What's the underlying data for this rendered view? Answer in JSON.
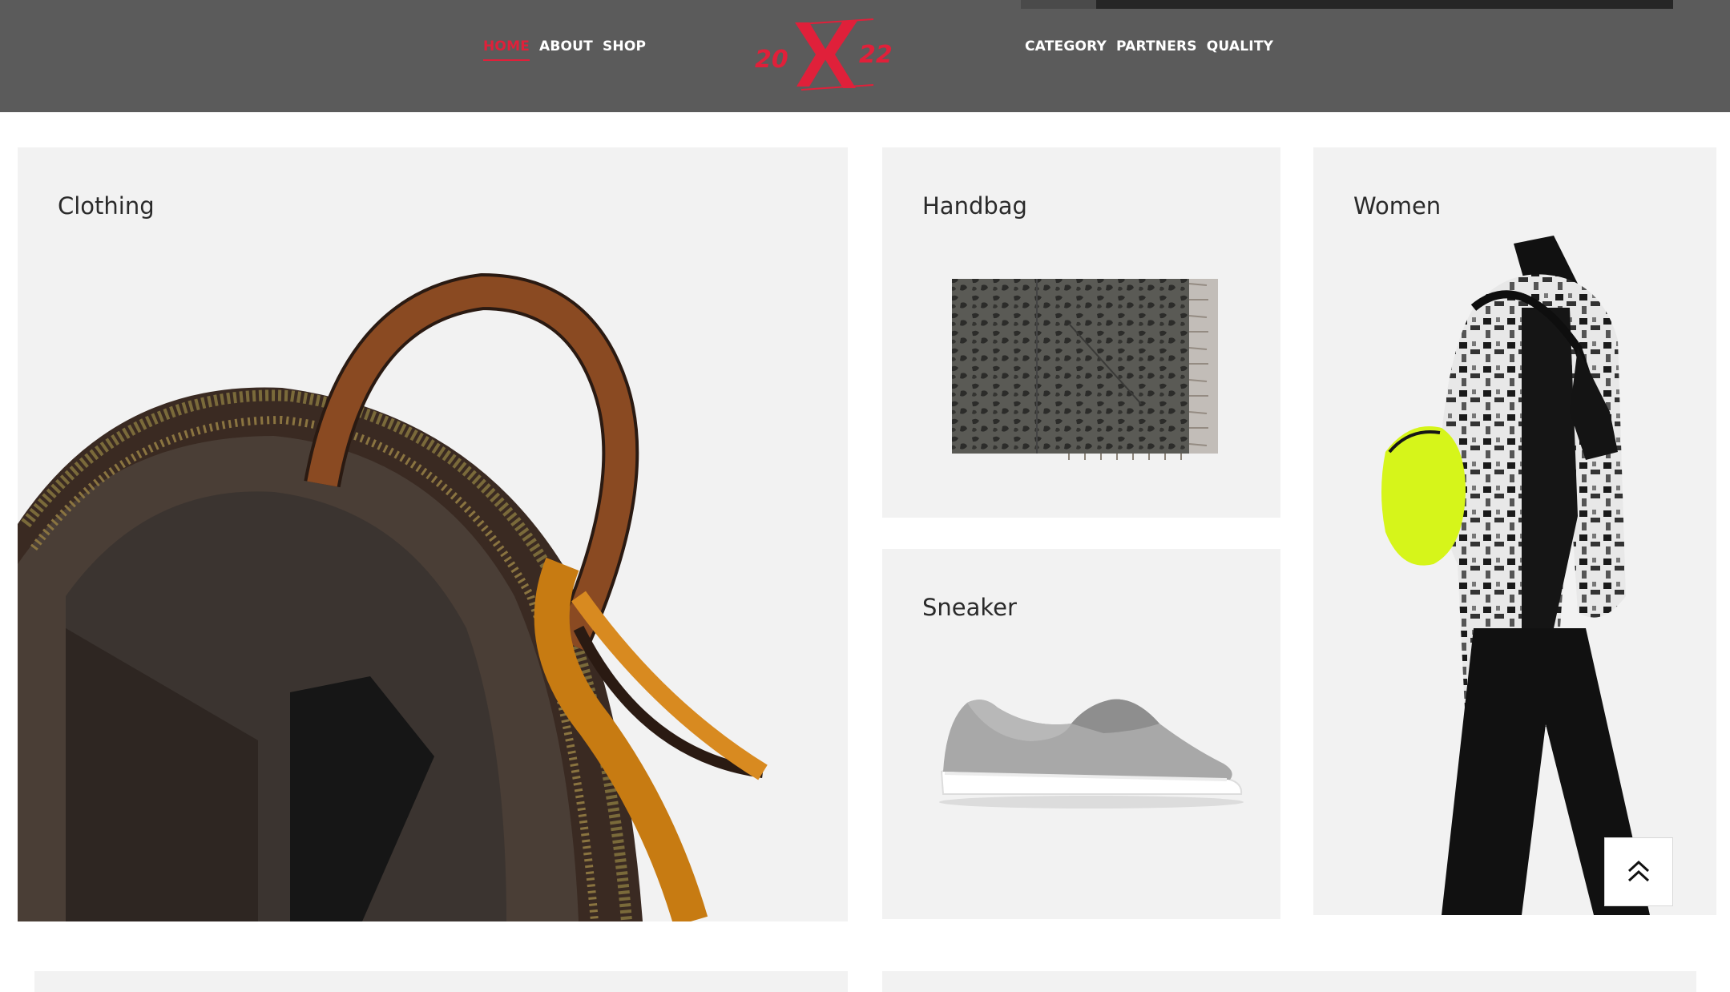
{
  "theme": {
    "header_bg": "#5b5b5b",
    "accent": "#e0203a",
    "card_bg": "#f2f2f2"
  },
  "nav_left": [
    {
      "label": "HOME",
      "active": true
    },
    {
      "label": "ABOUT",
      "active": false
    },
    {
      "label": "SHOP",
      "active": false
    }
  ],
  "nav_right": [
    {
      "label": "CATEGORY"
    },
    {
      "label": "PARTNERS"
    },
    {
      "label": "QUALITY"
    }
  ],
  "logo": {
    "text": "2022"
  },
  "cards": {
    "clothing": {
      "title": "Clothing",
      "image": "leather-backpack"
    },
    "handbag": {
      "title": "Handbag",
      "image": "patterned-scarf"
    },
    "sneaker": {
      "title": "Sneaker",
      "image": "grey-slip-on-sneaker"
    },
    "women": {
      "title": "Women",
      "image": "model-patterned-jacket"
    }
  },
  "scroll_top": {
    "icon": "double-chevron-up-icon"
  }
}
